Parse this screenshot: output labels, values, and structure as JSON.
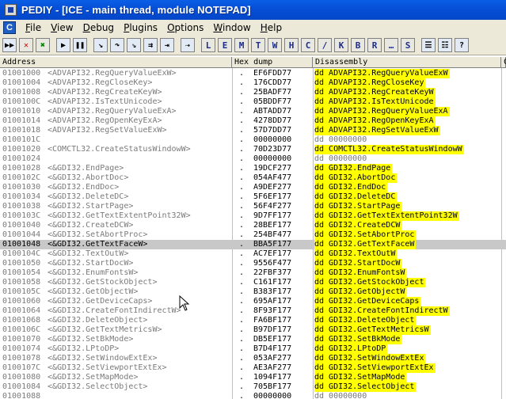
{
  "window": {
    "title": "PEDIY - [ICE - main thread, module NOTEPAD]"
  },
  "menu": {
    "app_icon": "C",
    "items": [
      {
        "label": "File",
        "key": "F"
      },
      {
        "label": "View",
        "key": "V"
      },
      {
        "label": "Debug",
        "key": "D"
      },
      {
        "label": "Plugins",
        "key": "P"
      },
      {
        "label": "Options",
        "key": "O"
      },
      {
        "label": "Window",
        "key": "W"
      },
      {
        "label": "Help",
        "key": "H"
      }
    ]
  },
  "toolbar": {
    "buttons": [
      {
        "name": "open-icon",
        "glyph": "▶▶",
        "style": "blue"
      },
      {
        "name": "close-icon",
        "glyph": "✕",
        "style": "red"
      },
      {
        "name": "restart-icon",
        "glyph": "✖",
        "style": "green sep"
      },
      {
        "name": "run-icon",
        "glyph": "▶",
        "style": "blue"
      },
      {
        "name": "pause-icon",
        "glyph": "❚❚",
        "style": "blue sep"
      },
      {
        "name": "step-into-icon",
        "glyph": "↘",
        "style": "blue"
      },
      {
        "name": "step-over-icon",
        "glyph": "↷",
        "style": "blue"
      },
      {
        "name": "trace-into-icon",
        "glyph": "⇘",
        "style": "blue"
      },
      {
        "name": "trace-over-icon",
        "glyph": "⇉",
        "style": "blue"
      },
      {
        "name": "execute-till-return-icon",
        "glyph": "⇥",
        "style": "blue sep"
      },
      {
        "name": "goto-icon",
        "glyph": "⇢",
        "style": "blue sep"
      },
      {
        "name": "log-window-icon",
        "glyph": "L",
        "style": "letter"
      },
      {
        "name": "modules-window-icon",
        "glyph": "E",
        "style": "letter"
      },
      {
        "name": "memory-window-icon",
        "glyph": "M",
        "style": "letter"
      },
      {
        "name": "threads-window-icon",
        "glyph": "T",
        "style": "letter"
      },
      {
        "name": "windows-window-icon",
        "glyph": "W",
        "style": "letter"
      },
      {
        "name": "handles-window-icon",
        "glyph": "H",
        "style": "letter"
      },
      {
        "name": "cpu-window-icon",
        "glyph": "C",
        "style": "letter"
      },
      {
        "name": "patches-window-icon",
        "glyph": "/",
        "style": "letter"
      },
      {
        "name": "call-stack-window-icon",
        "glyph": "K",
        "style": "letter"
      },
      {
        "name": "breakpoints-window-icon",
        "glyph": "B",
        "style": "letter"
      },
      {
        "name": "references-window-icon",
        "glyph": "R",
        "style": "letter"
      },
      {
        "name": "run-trace-window-icon",
        "glyph": "…",
        "style": "letter"
      },
      {
        "name": "source-window-icon",
        "glyph": "S",
        "style": "letter sep"
      },
      {
        "name": "list-icon",
        "glyph": "☰",
        "style": "blue"
      },
      {
        "name": "options-list-icon",
        "glyph": "☷",
        "style": "blue"
      },
      {
        "name": "help-icon",
        "glyph": "?",
        "style": "blue"
      }
    ]
  },
  "columns": {
    "address": "Address",
    "hex": "Hex dump",
    "disassembly": "Disassembly",
    "comment": "C"
  },
  "rows": [
    {
      "addr": "01001000",
      "sym": "<ADVAPI32.RegQueryValueExW>",
      "hex": "EF6FDD77",
      "dis": "dd ADVAPI32.RegQueryValueExW",
      "hl": true
    },
    {
      "addr": "01001004",
      "sym": "<ADVAPI32.RegCloseKey>",
      "hex": "176CDD77",
      "dis": "dd ADVAPI32.RegCloseKey",
      "hl": true
    },
    {
      "addr": "01001008",
      "sym": "<ADVAPI32.RegCreateKeyW>",
      "hex": "25BADF77",
      "dis": "dd ADVAPI32.RegCreateKeyW",
      "hl": true
    },
    {
      "addr": "0100100C",
      "sym": "<ADVAPI32.IsTextUnicode>",
      "hex": "05BDDF77",
      "dis": "dd ADVAPI32.IsTextUnicode",
      "hl": true
    },
    {
      "addr": "01001010",
      "sym": "<ADVAPI32.RegQueryValueExA>",
      "hex": "ABTADD77",
      "dis": "dd ADVAPI32.RegQueryValueExA",
      "hl": true
    },
    {
      "addr": "01001014",
      "sym": "<ADVAPI32.RegOpenKeyExA>",
      "hex": "4278DD77",
      "dis": "dd ADVAPI32.RegOpenKeyExA",
      "hl": true
    },
    {
      "addr": "01001018",
      "sym": "<ADVAPI32.RegSetValueExW>",
      "hex": "57D7DD77",
      "dis": "dd ADVAPI32.RegSetValueExW",
      "hl": true
    },
    {
      "addr": "0100101C",
      "sym": "",
      "hex": "00000000",
      "dis": "dd 00000000",
      "hl": false
    },
    {
      "addr": "01001020",
      "sym": "<COMCTL32.CreateStatusWindowW>",
      "hex": "70D23D77",
      "dis": "dd COMCTL32.CreateStatusWindowW",
      "hl": true
    },
    {
      "addr": "01001024",
      "sym": "",
      "hex": "00000000",
      "dis": "dd 00000000",
      "hl": false
    },
    {
      "addr": "01001028",
      "sym": "<&GDI32.EndPage>",
      "hex": "19DCF277",
      "dis": "dd GDI32.EndPage",
      "hl": true
    },
    {
      "addr": "0100102C",
      "sym": "<&GDI32.AbortDoc>",
      "hex": "054AF477",
      "dis": "dd GDI32.AbortDoc",
      "hl": true
    },
    {
      "addr": "01001030",
      "sym": "<&GDI32.EndDoc>",
      "hex": "A9DEF277",
      "dis": "dd GDI32.EndDoc",
      "hl": true
    },
    {
      "addr": "01001034",
      "sym": "<&GDI32.DeleteDC>",
      "hex": "5F6EF177",
      "dis": "dd GDI32.DeleteDC",
      "hl": true
    },
    {
      "addr": "01001038",
      "sym": "<&GDI32.StartPage>",
      "hex": "56F4F277",
      "dis": "dd GDI32.StartPage",
      "hl": true
    },
    {
      "addr": "0100103C",
      "sym": "<&GDI32.GetTextExtentPoint32W>",
      "hex": "9D7FF177",
      "dis": "dd GDI32.GetTextExtentPoint32W",
      "hl": true
    },
    {
      "addr": "01001040",
      "sym": "<&GDI32.CreateDCW>",
      "hex": "28BEF177",
      "dis": "dd GDI32.CreateDCW",
      "hl": true
    },
    {
      "addr": "01001044",
      "sym": "<&GDI32.SetAbortProc>",
      "hex": "254BF477",
      "dis": "dd GDI32.SetAbortProc",
      "hl": true
    },
    {
      "addr": "01001048",
      "sym": "<&GDI32.GetTextFaceW>",
      "hex": "BBA5F177",
      "dis": "dd GDI32.GetTextFaceW",
      "hl": true,
      "sel": true
    },
    {
      "addr": "0100104C",
      "sym": "<&GDI32.TextOutW>",
      "hex": "AC7EF177",
      "dis": "dd GDI32.TextOutW",
      "hl": true
    },
    {
      "addr": "01001050",
      "sym": "<&GDI32.StartDocW>",
      "hex": "9556F477",
      "dis": "dd GDI32.StartDocW",
      "hl": true
    },
    {
      "addr": "01001054",
      "sym": "<&GDI32.EnumFontsW>",
      "hex": "22FBF377",
      "dis": "dd GDI32.EnumFontsW",
      "hl": true
    },
    {
      "addr": "01001058",
      "sym": "<&GDI32.GetStockObject>",
      "hex": "C161F177",
      "dis": "dd GDI32.GetStockObject",
      "hl": true
    },
    {
      "addr": "0100105C",
      "sym": "<&GDI32.GetObjectW>",
      "hex": "B383F177",
      "dis": "dd GDI32.GetObjectW",
      "hl": true
    },
    {
      "addr": "01001060",
      "sym": "<&GDI32.GetDeviceCaps>",
      "hex": "695AF177",
      "dis": "dd GDI32.GetDeviceCaps",
      "hl": true
    },
    {
      "addr": "01001064",
      "sym": "<&GDI32.CreateFontIndirectW>",
      "hex": "8F93F177",
      "dis": "dd GDI32.CreateFontIndirectW",
      "hl": true
    },
    {
      "addr": "01001068",
      "sym": "<&GDI32.DeleteObject>",
      "hex": "FA6BF177",
      "dis": "dd GDI32.DeleteObject",
      "hl": true
    },
    {
      "addr": "0100106C",
      "sym": "<&GDI32.GetTextMetricsW>",
      "hex": "B97DF177",
      "dis": "dd GDI32.GetTextMetricsW",
      "hl": true
    },
    {
      "addr": "01001070",
      "sym": "<&GDI32.SetBkMode>",
      "hex": "DB5EF177",
      "dis": "dd GDI32.SetBkMode",
      "hl": true
    },
    {
      "addr": "01001074",
      "sym": "<&GDI32.LPtoDP>",
      "hex": "B7D4F177",
      "dis": "dd GDI32.LPtoDP",
      "hl": true
    },
    {
      "addr": "01001078",
      "sym": "<&GDI32.SetWindowExtEx>",
      "hex": "053AF277",
      "dis": "dd GDI32.SetWindowExtEx",
      "hl": true
    },
    {
      "addr": "0100107C",
      "sym": "<&GDI32.SetViewportExtEx>",
      "hex": "AE3AF277",
      "dis": "dd GDI32.SetViewportExtEx",
      "hl": true
    },
    {
      "addr": "01001080",
      "sym": "<&GDI32.SetMapMode>",
      "hex": "1094F177",
      "dis": "dd GDI32.SetMapMode",
      "hl": true
    },
    {
      "addr": "01001084",
      "sym": "<&GDI32.SelectObject>",
      "hex": "705BF177",
      "dis": "dd GDI32.SelectObject",
      "hl": true
    },
    {
      "addr": "01001088",
      "sym": "",
      "hex": "00000000",
      "dis": "dd 00000000",
      "hl": false
    }
  ]
}
